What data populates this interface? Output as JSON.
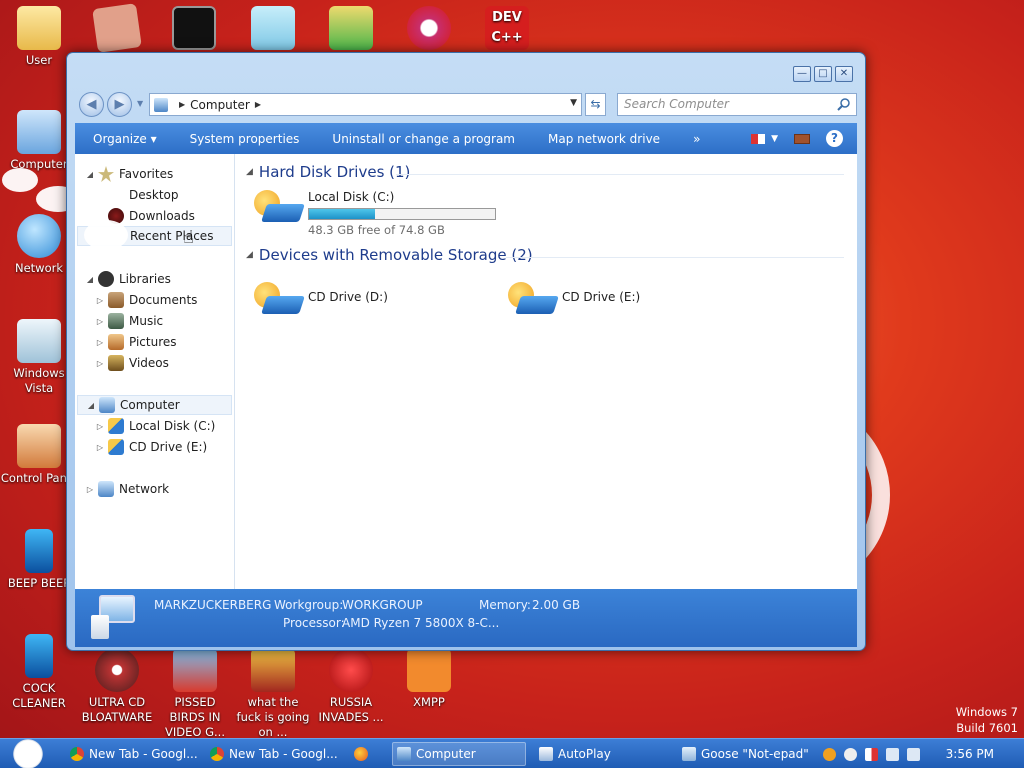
{
  "desktop": {
    "icons": [
      {
        "label": "User"
      },
      {
        "label": "Computer"
      },
      {
        "label": "Network"
      },
      {
        "label": "Windows Vista"
      },
      {
        "label": "Control Panel"
      },
      {
        "label": "BEEP BEEP"
      },
      {
        "label": "COCK CLEANER"
      },
      {
        "label": "ULTRA CD BLOATWARE"
      },
      {
        "label": "PISSED BIRDS IN VIDEO G..."
      },
      {
        "label": "what the fuck is going on ..."
      },
      {
        "label": "RUSSIA INVADES ..."
      },
      {
        "label": "XMPP"
      },
      {
        "label": "DEV C++"
      }
    ],
    "watermark": {
      "line1": "Windows 7",
      "line2": "Build 7601"
    }
  },
  "window": {
    "buttons": {
      "minimize": "—",
      "maximize": "□",
      "close": "✕"
    },
    "address": {
      "crumbs": [
        "Computer"
      ]
    },
    "search": {
      "placeholder": "Search Computer"
    },
    "toolbar": {
      "items": [
        "Organize ▾",
        "System properties",
        "Uninstall or change a program",
        "Map network drive",
        "»"
      ]
    },
    "nav": {
      "favorites": "Favorites",
      "desktop": "Desktop",
      "downloads": "Downloads",
      "recent": "Recent Places",
      "libraries": "Libraries",
      "documents": "Documents",
      "music": "Music",
      "pictures": "Pictures",
      "videos": "Videos",
      "computer": "Computer",
      "local_disk": "Local Disk (C:)",
      "cd_drive": "CD Drive (E:)",
      "network": "Network"
    },
    "groups": {
      "hdd": "Hard Disk Drives (1)",
      "removable": "Devices with Removable Storage (2)"
    },
    "drives": {
      "c": {
        "name": "Local Disk (C:)",
        "free": "48.3 GB free of 74.8 GB",
        "used_fraction": 0.354
      },
      "d": {
        "name": "CD Drive (D:)"
      },
      "e": {
        "name": "CD Drive (E:)"
      }
    },
    "details": {
      "computer_name": "MARKZUCKERBERG",
      "workgroup_label": "Workgroup:",
      "workgroup": "WORKGROUP",
      "memory_label": "Memory:",
      "memory": "2.00 GB",
      "processor_label": "Processor:",
      "processor": "AMD Ryzen 7 5800X 8-C..."
    }
  },
  "taskbar": {
    "tasks": [
      "New Tab - Googl...",
      "New Tab - Googl...",
      "Computer",
      "AutoPlay",
      "Goose \"Not-epad\""
    ],
    "clock": "3:56 PM"
  }
}
